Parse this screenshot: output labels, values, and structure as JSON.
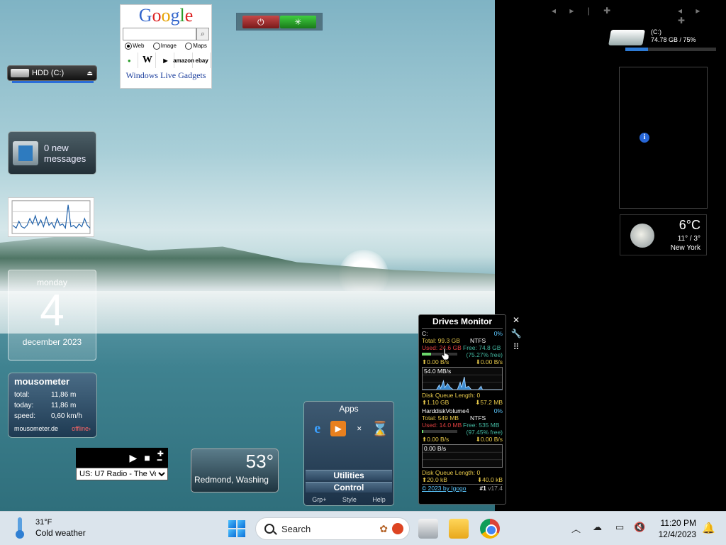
{
  "google_gadget": {
    "logo_letters": [
      "G",
      "o",
      "o",
      "g",
      "l",
      "e"
    ],
    "search_placeholder": "",
    "search_icon": "magnifier-icon",
    "radio_options": [
      "Web",
      "Image",
      "Maps"
    ],
    "selected_option": "Web",
    "site_links": [
      "wikipedia",
      "W",
      "youtube",
      "amazon",
      "ebay"
    ],
    "footer": "Windows Live Gadgets"
  },
  "power_gadget": {
    "shutdown_icon": "power-icon",
    "restart_icon": "sleep-icon"
  },
  "hdd_gadget": {
    "label": "HDD (C:)",
    "eject_icon": "eject-icon"
  },
  "mail_gadget": {
    "line1": "0 new",
    "line2": "messages"
  },
  "calendar_gadget": {
    "day_of_week": "monday",
    "day": "4",
    "month_year": "december 2023"
  },
  "mousometer": {
    "title": "mousometer",
    "rows": [
      {
        "key": "total:",
        "value": "11,86 m"
      },
      {
        "key": "today:",
        "value": "11,86 m"
      },
      {
        "key": "speed:",
        "value": "0,60 km/h"
      }
    ],
    "site": "mousometer.de",
    "status": "offline"
  },
  "radio_gadget": {
    "station": "US: U7 Radio - The Ve"
  },
  "weather_small": {
    "temperature": "53°",
    "location": "Redmond, Washing"
  },
  "apps_gadget": {
    "title": "Apps",
    "menu": [
      "Utilities",
      "Control"
    ],
    "footer": [
      "Grp+",
      "Style",
      "Help"
    ]
  },
  "drives_monitor": {
    "title": "Drives Monitor",
    "drive1": {
      "name": "C:",
      "percent": "0%",
      "total_label": "Total:",
      "total": "99.3 GB",
      "fs": "NTFS",
      "used_label": "Used:",
      "used": "24.6 GB",
      "free_label": "Free:",
      "free": "74.8 GB",
      "free_pct": "(75.27% free)",
      "read": "0.00 B/s",
      "write": "0.00 B/s",
      "chart_label": "54.0 MB/s",
      "queue": "Disk Queue Length: 0",
      "read_total": "1.10 GB",
      "write_total": "57.2 MB",
      "used_fraction": 0.25
    },
    "drive2": {
      "name": "HarddiskVolume4",
      "percent": "0%",
      "total_label": "Total:",
      "total": "549 MB",
      "fs": "NTFS",
      "used_label": "Used:",
      "used": "14.0 MB",
      "free_label": "Free:",
      "free": "535 MB",
      "free_pct": "(97.45% free)",
      "read": "0.00 B/s",
      "write": "0.00 B/s",
      "chart_label": "0.00 B/s",
      "queue": "Disk Queue Length: 0",
      "read_total": "20.0 kB",
      "write_total": "40.0 kB",
      "used_fraction": 0.03
    },
    "footer_link": "© 2023 by Igogo",
    "footer_rank": "#1",
    "footer_version": "v17.4"
  },
  "right_drive": {
    "label": "(C:)",
    "usage": "74.78 GB / 75%",
    "fill_fraction": 0.25
  },
  "right_weather": {
    "temperature": "6°C",
    "high_low": "11° / 3°",
    "city": "New York"
  },
  "taskbar": {
    "weather_temp": "31°F",
    "weather_text": "Cold weather",
    "search_label": "Search",
    "time": "11:20 PM",
    "date": "12/4/2023"
  }
}
